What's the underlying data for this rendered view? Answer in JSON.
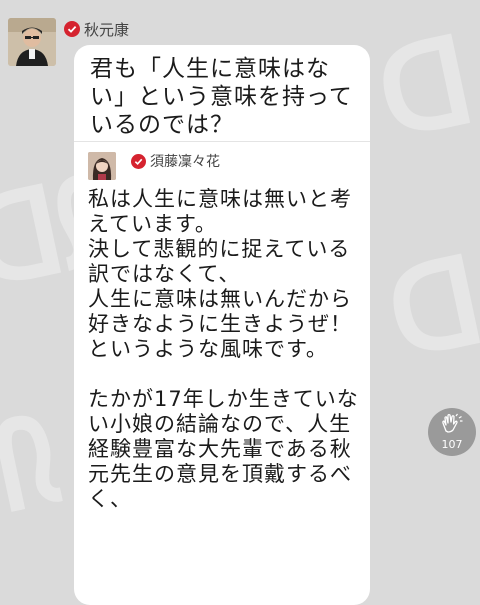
{
  "question": {
    "author": "秋元康",
    "text": "君も「人生に意味はない」という意味を持っているのでは？"
  },
  "reply": {
    "author": "須藤凜々花",
    "text": "私は人生に意味は無いと考えています。\n決して悲観的に捉えている訳ではなくて、\n人生に意味は無いんだから好きなように生きようぜ！\nというような風味です。\n\nたかが17年しか生きていない小娘の結論なので、人生経験豊富な大先輩である秋元先生の意見を頂戴するべく、"
  },
  "clap": {
    "count": "107"
  },
  "colors": {
    "verified": "#d5232f",
    "bubble": "#ffffff",
    "background": "#dadada",
    "clap_button": "#9a9a9a"
  },
  "icons": [
    "verified-check-icon",
    "clap-hands-icon"
  ]
}
